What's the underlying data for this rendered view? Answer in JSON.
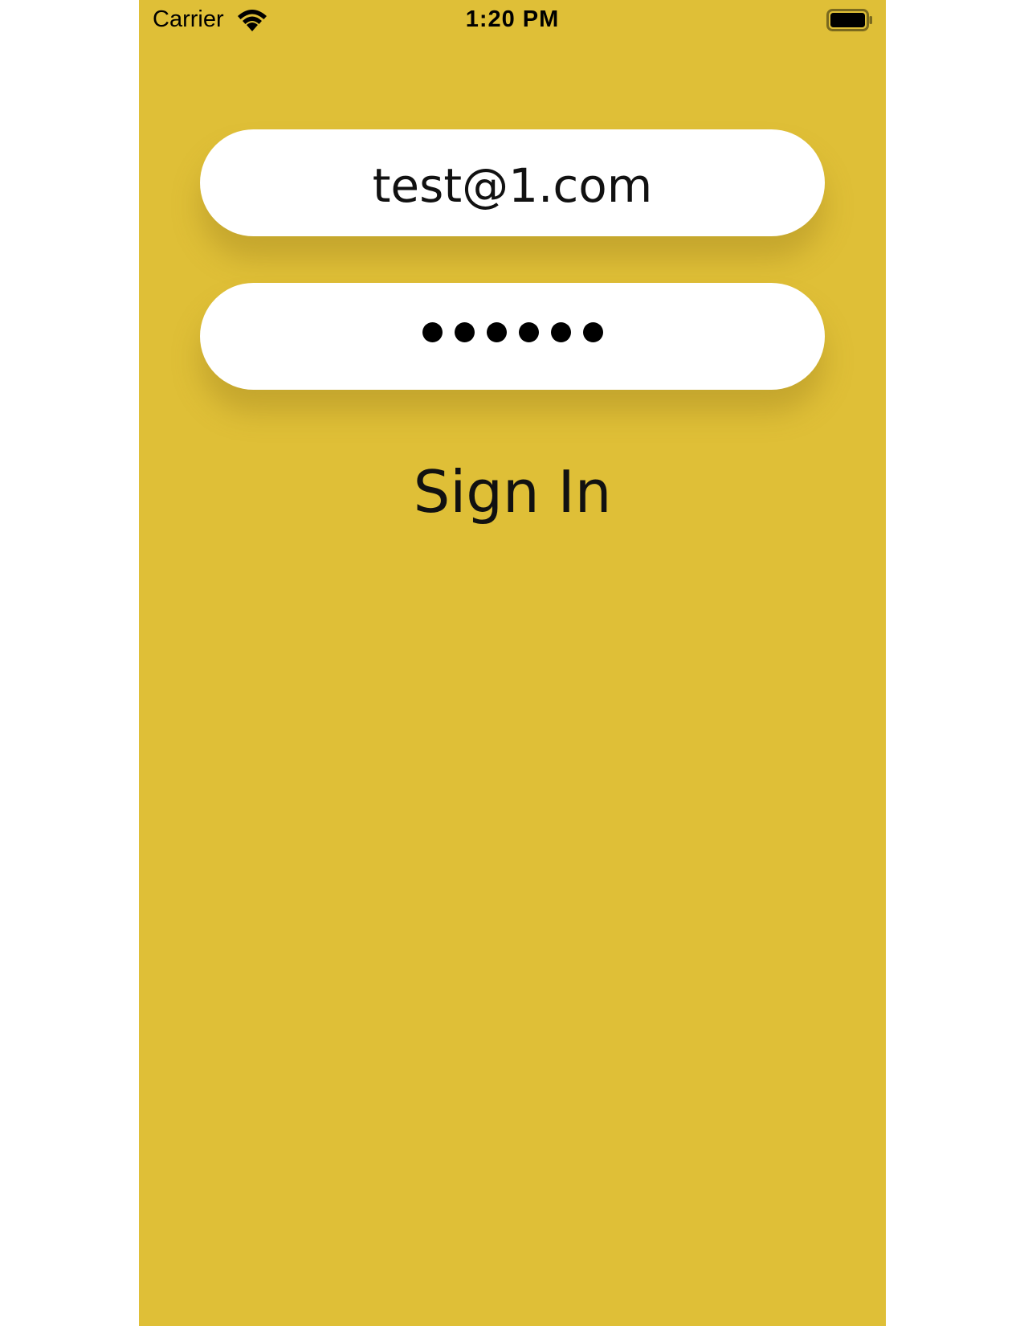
{
  "status_bar": {
    "carrier": "Carrier",
    "time": "1:20 PM",
    "icons": [
      "wifi-icon",
      "battery-icon"
    ]
  },
  "login": {
    "email_value": "test@1.com",
    "password_masked_length": 6,
    "sign_in_label": "Sign In"
  },
  "colors": {
    "background": "#dfbf37",
    "field": "#ffffff",
    "text": "#111111"
  }
}
